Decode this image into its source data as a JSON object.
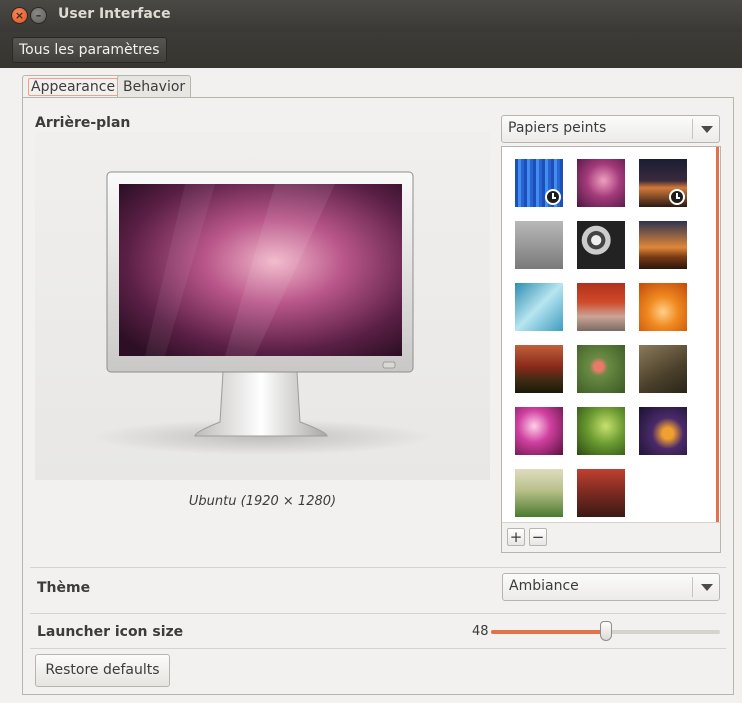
{
  "window": {
    "title": "User Interface",
    "close_symbol": "×",
    "minimize_symbol": "–"
  },
  "toolbar": {
    "all_settings": "Tous les paramètres"
  },
  "tabs": [
    {
      "label": "Appearance",
      "active": true
    },
    {
      "label": "Behavior",
      "active": false
    }
  ],
  "background": {
    "label": "Arrière-plan",
    "source_combo": "Papiers peints",
    "caption": "Ubuntu (1920 × 1280)",
    "add_symbol": "+",
    "remove_symbol": "−",
    "wallpapers": [
      {
        "name": "blue-streaks",
        "clock": true
      },
      {
        "name": "pink-purple-bokeh",
        "clock": false
      },
      {
        "name": "sunset-road",
        "clock": true
      },
      {
        "name": "foggy-deer",
        "clock": false
      },
      {
        "name": "gears",
        "clock": false
      },
      {
        "name": "orange-horizon",
        "clock": false
      },
      {
        "name": "cyan-ice",
        "clock": false
      },
      {
        "name": "red-trees-path",
        "clock": false
      },
      {
        "name": "orange-leaves",
        "clock": false
      },
      {
        "name": "red-valley",
        "clock": false
      },
      {
        "name": "pink-flowers-green",
        "clock": false
      },
      {
        "name": "fountain-pen",
        "clock": false
      },
      {
        "name": "pink-flower-macro",
        "clock": false
      },
      {
        "name": "green-leaves-bokeh",
        "clock": false
      },
      {
        "name": "purple-horse",
        "clock": false
      },
      {
        "name": "grass-field",
        "clock": false
      },
      {
        "name": "red-chain",
        "clock": false
      }
    ]
  },
  "theme": {
    "label": "Thème",
    "value": "Ambiance"
  },
  "launcher": {
    "label": "Launcher icon size",
    "value": "48",
    "fraction": 0.5
  },
  "restore_button": "Restore defaults",
  "colors": {
    "accent": "#e0734b",
    "titlebar": "#3c3b37",
    "window_bg": "#f2f1f0"
  }
}
